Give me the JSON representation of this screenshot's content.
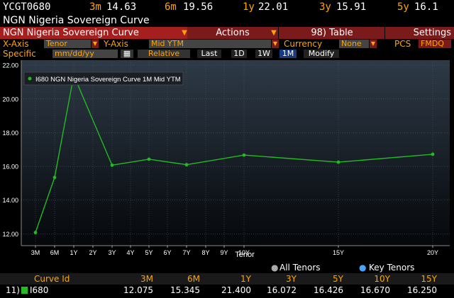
{
  "ticker": {
    "code": "YCGT0680",
    "items": [
      {
        "key": "3m",
        "val": "14.63"
      },
      {
        "key": "6m",
        "val": "19.56"
      },
      {
        "key": "1y",
        "val": "22.01"
      },
      {
        "key": "3y",
        "val": "15.91"
      },
      {
        "key": "5y",
        "val": "16.1"
      }
    ]
  },
  "title": "NGN Nigeria Sovereign Curve",
  "menu": {
    "curve_name": "NGN Nigeria Sovereign Curve",
    "actions": "Actions",
    "table": "98) Table",
    "settings": "Settings"
  },
  "axis_row": {
    "x_axis_label": "X-Axis",
    "x_axis_value": "Tenor",
    "y_axis_label": "Y-Axis",
    "y_axis_value": "Mid YTM",
    "currency_label": "Currency",
    "currency_value": "None",
    "pcs_label": "PCS",
    "pcs_value": "FMDQ"
  },
  "spec_row": {
    "specific_label": "Specific",
    "date_placeholder": "mm/dd/yy",
    "calendar_icon": "calendar-icon",
    "relative": "Relative",
    "last": "Last",
    "btn_1d": "1D",
    "btn_1w": "1W",
    "btn_1m": "1M",
    "modify": "Modify"
  },
  "chart_data": {
    "type": "line",
    "legend": "I680 NGN Nigeria Sovereign Curve 1M Mid YTM",
    "xlabel": "Tenor",
    "ylabel": "",
    "ylim": [
      11.3,
      22.3
    ],
    "yticks": [
      "22.00",
      "20.00",
      "18.00",
      "16.00",
      "14.00",
      "12.00"
    ],
    "ytick_values": [
      22,
      20,
      18,
      16,
      14,
      12
    ],
    "x_tick_labels": [
      "3M",
      "6M",
      "1Y",
      "2Y",
      "3Y",
      "4Y",
      "5Y",
      "6Y",
      "7Y",
      "8Y",
      "9Y",
      "10Y",
      "15Y",
      "20Y"
    ],
    "x_tick_years": [
      0.25,
      0.5,
      1,
      2,
      3,
      4,
      5,
      6,
      7,
      8,
      9,
      10,
      15,
      20
    ],
    "points": [
      {
        "tenor": "3M",
        "x": 0.25,
        "y": 12.075
      },
      {
        "tenor": "6M",
        "x": 0.5,
        "y": 15.345
      },
      {
        "tenor": "1Y",
        "x": 1,
        "y": 21.4
      },
      {
        "tenor": "3Y",
        "x": 3,
        "y": 16.072
      },
      {
        "tenor": "5Y",
        "x": 5,
        "y": 16.426
      },
      {
        "tenor": "7Y",
        "x": 7,
        "y": 16.1
      },
      {
        "tenor": "10Y",
        "x": 10,
        "y": 16.67
      },
      {
        "tenor": "15Y",
        "x": 15,
        "y": 16.25
      },
      {
        "tenor": "20Y",
        "x": 20,
        "y": 16.72
      }
    ],
    "line_color": "#22bb22",
    "grid": true
  },
  "tenor_opts": {
    "all": "All Tenors",
    "key": "Key Tenors"
  },
  "table": {
    "headers": [
      "Curve Id",
      "3M",
      "6M",
      "1Y",
      "3Y",
      "5Y",
      "10Y",
      "15Y"
    ],
    "row": {
      "index": "11)",
      "id": "I680",
      "values": [
        "12.075",
        "15.345",
        "21.400",
        "16.072",
        "16.426",
        "16.670",
        "16.250"
      ]
    }
  },
  "colors": {
    "orange": "#ffa500",
    "menu_red": "#7a1a1a",
    "active_blue": "#1a3a80",
    "series_green": "#22bb22"
  }
}
